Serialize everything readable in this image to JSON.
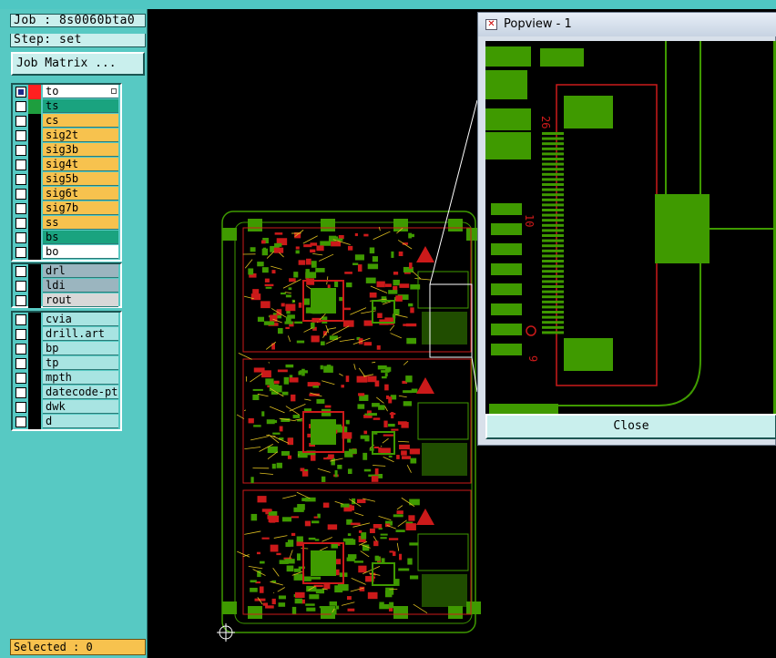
{
  "job": {
    "label": "Job : 8s0060bta0",
    "step": "Step: set"
  },
  "job_matrix_label": "Job Matrix ...",
  "layers": {
    "group1": [
      {
        "name": "to",
        "color": "#ff2020",
        "bg": "#ffffff",
        "checked": true,
        "active": true
      },
      {
        "name": "ts",
        "color": "#1e9e3e",
        "bg": "#1aa37f",
        "checked": false
      },
      {
        "name": "cs",
        "color": "#000000",
        "bg": "#f7c24e",
        "checked": false
      },
      {
        "name": "sig2t",
        "color": "#000000",
        "bg": "#f7c24e",
        "checked": false
      },
      {
        "name": "sig3b",
        "color": "#000000",
        "bg": "#f7c24e",
        "checked": false
      },
      {
        "name": "sig4t",
        "color": "#000000",
        "bg": "#f7c24e",
        "checked": false
      },
      {
        "name": "sig5b",
        "color": "#000000",
        "bg": "#f7c24e",
        "checked": false
      },
      {
        "name": "sig6t",
        "color": "#000000",
        "bg": "#f7c24e",
        "checked": false
      },
      {
        "name": "sig7b",
        "color": "#000000",
        "bg": "#f7c24e",
        "checked": false
      },
      {
        "name": "ss",
        "color": "#000000",
        "bg": "#f7c24e",
        "checked": false
      },
      {
        "name": "bs",
        "color": "#000000",
        "bg": "#1aa37f",
        "checked": false
      },
      {
        "name": "bo",
        "color": "#000000",
        "bg": "#ffffff",
        "checked": false
      }
    ],
    "group2": [
      {
        "name": "drl",
        "color": "#000000",
        "bg": "#9bb5bf",
        "checked": false
      },
      {
        "name": "ldi",
        "color": "#000000",
        "bg": "#9bb5bf",
        "checked": false
      },
      {
        "name": "rout",
        "color": "#000000",
        "bg": "#d8d8d8",
        "checked": false
      }
    ],
    "group3": [
      {
        "name": "cvia",
        "color": "#000000",
        "bg": "#a8e4e2",
        "checked": false
      },
      {
        "name": "drill.art",
        "color": "#000000",
        "bg": "#a8e4e2",
        "checked": false
      },
      {
        "name": "bp",
        "color": "#000000",
        "bg": "#a8e4e2",
        "checked": false
      },
      {
        "name": "tp",
        "color": "#000000",
        "bg": "#a8e4e2",
        "checked": false
      },
      {
        "name": "mpth",
        "color": "#000000",
        "bg": "#a8e4e2",
        "checked": false
      },
      {
        "name": "datecode-pte",
        "color": "#000000",
        "bg": "#a8e4e2",
        "checked": false
      },
      {
        "name": "dwk",
        "color": "#000000",
        "bg": "#a8e4e2",
        "checked": false
      },
      {
        "name": "d",
        "color": "#000000",
        "bg": "#a8e4e2",
        "checked": false
      }
    ]
  },
  "status": "Selected : 0",
  "popview": {
    "title": "Popview - 1",
    "close_label": "Close",
    "silk_labels": [
      "26",
      "10",
      "9"
    ]
  },
  "colors": {
    "panel": "#57c9c3",
    "pad": "#3f9a00",
    "trace": "#cc1a1a"
  },
  "icons": {
    "popview_window": "window-icon",
    "origin": "crosshair-origin-icon"
  }
}
